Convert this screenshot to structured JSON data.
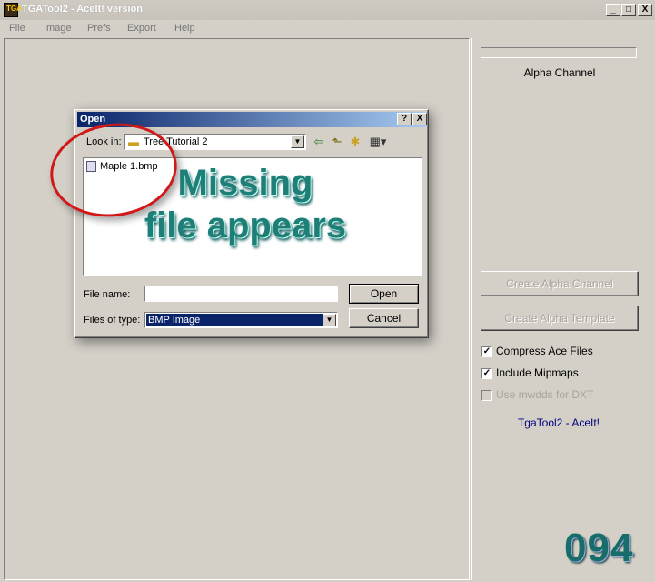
{
  "window": {
    "title": "TGATool2 - AceIt! version",
    "icon_text": "TGA",
    "controls": {
      "minimize": "_",
      "maximize": "□",
      "close": "X"
    }
  },
  "menu": {
    "items": [
      "File",
      "Image",
      "Prefs",
      "Export",
      "Help"
    ]
  },
  "right_panel": {
    "progress": 0,
    "channel_label": "Alpha Channel",
    "create_alpha_channel": "Create Alpha Channel",
    "create_alpha_template": "Create Alpha Template",
    "compress_ace": {
      "label": "Compress Ace Files",
      "checked": true
    },
    "include_mipmaps": {
      "label": "Include Mipmaps",
      "checked": true
    },
    "use_mwdds": {
      "label": "Use mwdds for DXT",
      "checked": false,
      "disabled": true
    },
    "app_name": "TgaTool2 - AceIt!"
  },
  "dialog": {
    "title": "Open",
    "help_btn": "?",
    "close_btn": "X",
    "lookin_label": "Look in:",
    "lookin_value": "Tree Tutorial 2",
    "files": [
      {
        "name": "Maple 1.bmp",
        "type": "bmp"
      }
    ],
    "filename_label": "File name:",
    "filename_value": "",
    "filetype_label": "Files of type:",
    "filetype_value": "BMP Image",
    "open_btn": "Open",
    "cancel_btn": "Cancel"
  },
  "annotations": {
    "overlay_line1": "Missing",
    "overlay_line2": "file appears",
    "page_code": "094"
  },
  "colors": {
    "dialog_title": "#0a246a",
    "selected_type": "#0a246a",
    "overlay_text": "#1e7e78",
    "circle": "#d01818",
    "app_name": "#000080"
  }
}
